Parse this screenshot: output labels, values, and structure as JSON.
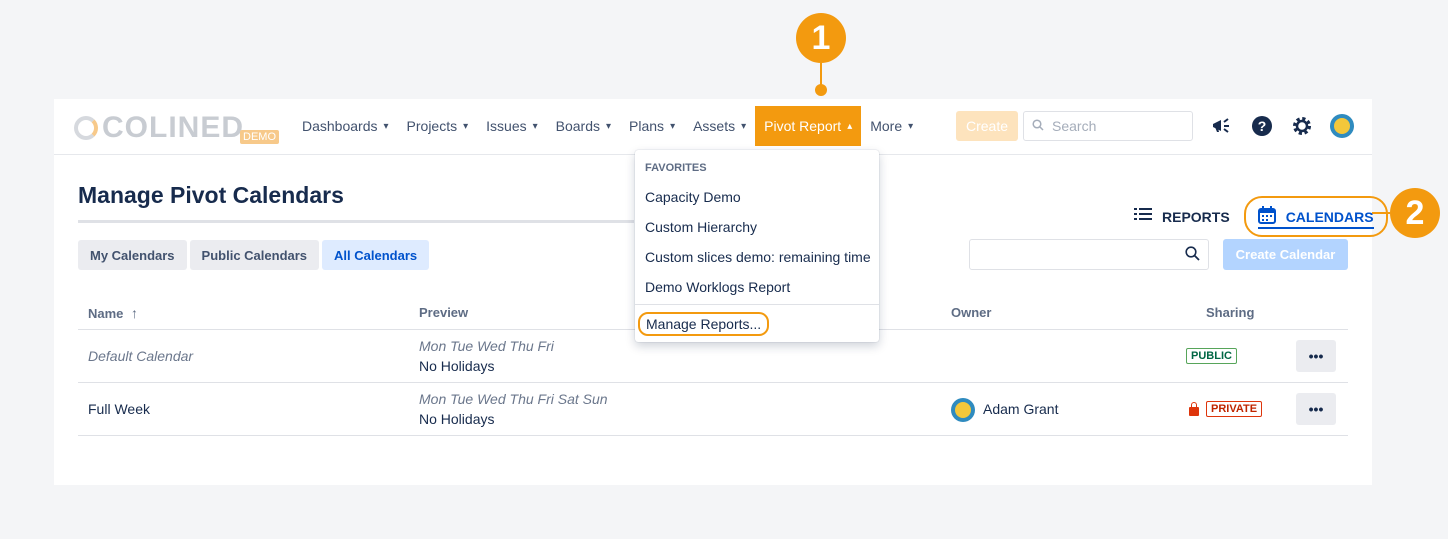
{
  "callouts": {
    "one": "1",
    "two": "2"
  },
  "nav": {
    "logo": "COLINED",
    "logo_badge": "DEMO",
    "items": [
      {
        "label": "Dashboards",
        "chevron": "▾"
      },
      {
        "label": "Projects",
        "chevron": "▾"
      },
      {
        "label": "Issues",
        "chevron": "▾"
      },
      {
        "label": "Boards",
        "chevron": "▾"
      },
      {
        "label": "Plans",
        "chevron": "▾"
      },
      {
        "label": "Assets",
        "chevron": "▾"
      },
      {
        "label": "Pivot Report",
        "chevron": "▴"
      },
      {
        "label": "More",
        "chevron": "▾"
      }
    ],
    "create": "Create",
    "search_placeholder": "Search",
    "icons": [
      "megaphone-icon",
      "help-icon",
      "gear-icon",
      "avatar"
    ]
  },
  "dropdown": {
    "header": "FAVORITES",
    "items": [
      "Capacity Demo",
      "Custom Hierarchy",
      "Custom slices demo: remaining time",
      "Demo Worklogs Report"
    ],
    "manage": "Manage Reports..."
  },
  "page": {
    "title": "Manage Pivot Calendars",
    "view_reports": "REPORTS",
    "view_calendars": "CALENDARS",
    "tabs": [
      "My Calendars",
      "Public Calendars",
      "All Calendars"
    ],
    "selected_tab": "All Calendars",
    "create_calendar": "Create Calendar"
  },
  "table": {
    "headers": {
      "name": "Name",
      "sort": "↑",
      "preview": "Preview",
      "owner": "Owner",
      "sharing": "Sharing"
    },
    "rows": [
      {
        "name": "Default Calendar",
        "days": "Mon Tue Wed Thu Fri",
        "holidays": "No Holidays",
        "owner": "",
        "sharing": "PUBLIC",
        "more": "•••"
      },
      {
        "name": "Full Week",
        "days": "Mon Tue Wed Thu Fri Sat Sun",
        "holidays": "No Holidays",
        "owner": "Adam Grant",
        "sharing": "PRIVATE",
        "more": "•••"
      }
    ]
  },
  "colors": {
    "accent": "#f39a0f",
    "primary": "#0052cc"
  }
}
